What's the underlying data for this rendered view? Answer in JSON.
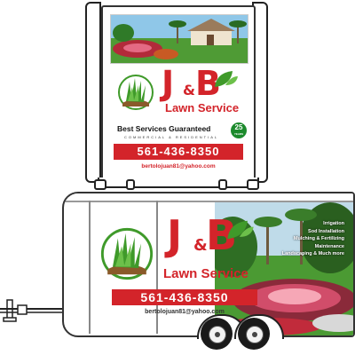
{
  "brand": {
    "logo_text": "J&B",
    "logo_j": "J",
    "logo_amp": "&",
    "logo_b": "B",
    "name": "Lawn Service",
    "tagline": "Best Services Guaranteed",
    "subtagline": "COMMERCIAL & RESIDENTIAL",
    "badge_number": "25",
    "badge_caption": "YEARS",
    "phone": "561-436-8350",
    "email": "bertolojuan81@yahoo.com"
  },
  "services": [
    "Irrigation",
    "Sod Installation",
    "Mulching & Fertilizing",
    "Maintenance",
    "Landscaping & Much more"
  ],
  "colors": {
    "brand_red": "#d3242a",
    "grass_green": "#3f9a2a",
    "badge_green": "#1c8a2c"
  }
}
